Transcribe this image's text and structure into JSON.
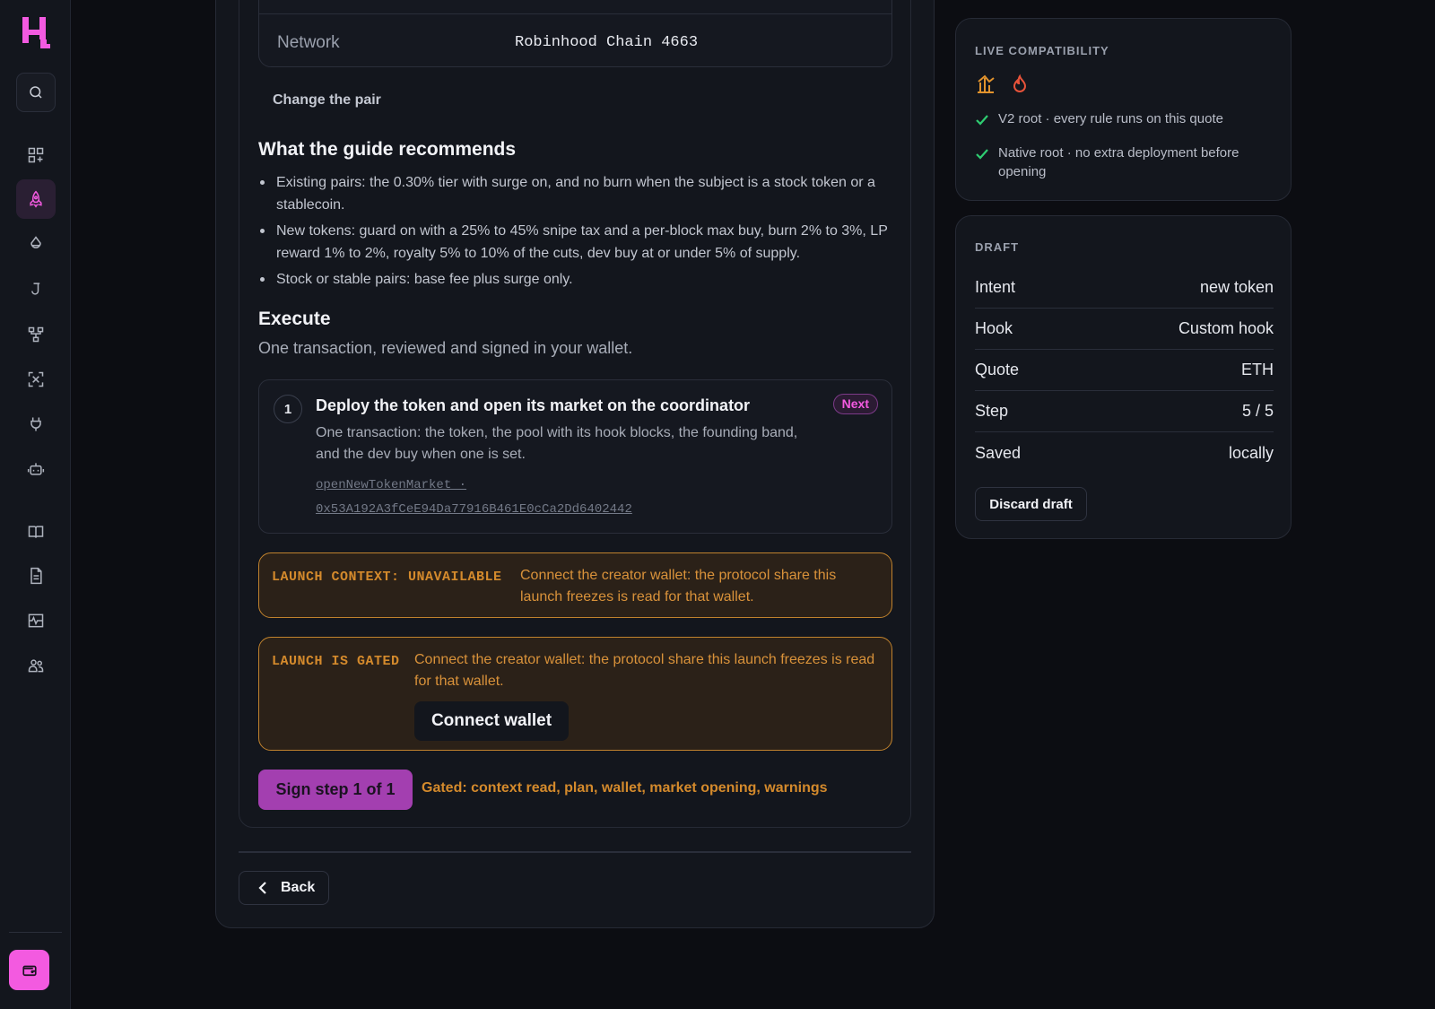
{
  "network": {
    "label": "Network",
    "value": "Robinhood Chain 4663"
  },
  "change_pair": "Change the pair",
  "guide": {
    "title": "What the guide recommends",
    "items": [
      "Existing pairs: the 0.30% tier with surge on, and no burn when the subject is a stock token or a stablecoin.",
      "New tokens: guard on with a 25% to 45% snipe tax and a per-block max buy, burn 2% to 3%, LP reward 1% to 2%, royalty 5% to 10% of the cuts, dev buy at or under 5% of supply.",
      "Stock or stable pairs: base fee plus surge only."
    ]
  },
  "execute": {
    "title": "Execute",
    "subtitle": "One transaction, reviewed and signed in your wallet."
  },
  "step": {
    "number": "1",
    "title": "Deploy the token and open its market on the coordinator",
    "badge": "Next",
    "description": "One transaction: the token, the pool with its hook blocks, the founding band, and the dev buy when one is set.",
    "link": "openNewTokenMarket · 0x53A192A3fCeE94Da77916B461E0cCa2Dd6402442"
  },
  "warnings": [
    {
      "tag": "LAUNCH CONTEXT: UNAVAILABLE",
      "text": "Connect the creator wallet: the protocol share this launch freezes is read for that wallet."
    },
    {
      "tag": "LAUNCH IS GATED",
      "text": "Connect the creator wallet: the protocol share this launch freezes is read for that wallet.",
      "button": "Connect wallet"
    }
  ],
  "sign": {
    "button": "Sign step 1 of 1",
    "gated": "Gated: context read, plan, wallet, market opening, warnings"
  },
  "back_label": "Back",
  "compat": {
    "title": "LIVE COMPATIBILITY",
    "icons": [
      "chart-bar-icon",
      "flame-icon"
    ],
    "items": [
      "V2 root · every rule runs on this quote",
      "Native root · no extra deployment before opening"
    ]
  },
  "draft": {
    "title": "DRAFT",
    "rows": [
      {
        "k": "Intent",
        "v": "new token"
      },
      {
        "k": "Hook",
        "v": "Custom hook"
      },
      {
        "k": "Quote",
        "v": "ETH"
      },
      {
        "k": "Step",
        "v": "5 / 5"
      },
      {
        "k": "Saved",
        "v": "locally"
      }
    ],
    "discard": "Discard draft"
  },
  "colors": {
    "accent": "#f35ae0",
    "warning": "#d48a2c",
    "sign_button": "#a33fb0",
    "check": "#2ecc71",
    "background": "#0c0d12"
  },
  "nav_icons": [
    "search-icon",
    "dashboard-icon",
    "rocket-icon",
    "drop-icon",
    "j-icon",
    "network-icon",
    "scan-icon",
    "plug-icon",
    "robot-icon",
    "book-icon",
    "document-icon",
    "activity-icon",
    "users-icon",
    "wallet-icon"
  ]
}
